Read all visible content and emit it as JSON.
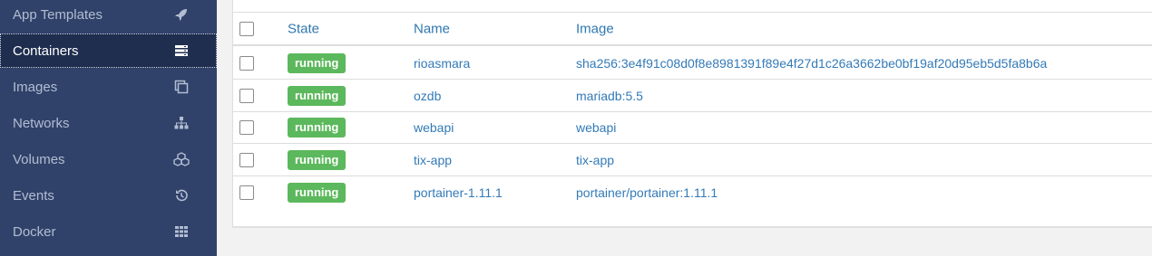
{
  "sidebar": {
    "items": [
      {
        "label": "App Templates",
        "icon": "rocket-icon",
        "active": false
      },
      {
        "label": "Containers",
        "icon": "server-icon",
        "active": true
      },
      {
        "label": "Images",
        "icon": "clone-icon",
        "active": false
      },
      {
        "label": "Networks",
        "icon": "sitemap-icon",
        "active": false
      },
      {
        "label": "Volumes",
        "icon": "cubes-icon",
        "active": false
      },
      {
        "label": "Events",
        "icon": "history-icon",
        "active": false
      },
      {
        "label": "Docker",
        "icon": "grid-icon",
        "active": false
      }
    ]
  },
  "table": {
    "headers": {
      "state": "State",
      "name": "Name",
      "image": "Image"
    },
    "rows": [
      {
        "state": "running",
        "name": "rioasmara",
        "image": "sha256:3e4f91c08d0f8e8981391f89e4f27d1c26a3662be0bf19af20d95eb5d5fa8b6a"
      },
      {
        "state": "running",
        "name": "ozdb",
        "image": "mariadb:5.5"
      },
      {
        "state": "running",
        "name": "webapi",
        "image": "webapi"
      },
      {
        "state": "running",
        "name": "tix-app",
        "image": "tix-app"
      },
      {
        "state": "running",
        "name": "portainer-1.11.1",
        "image": "portainer/portainer:1.11.1"
      }
    ]
  },
  "colors": {
    "sidebar_bg": "#30426a",
    "active_bg": "#1f2e4f",
    "link": "#337ab7",
    "running": "#5cb85c"
  }
}
